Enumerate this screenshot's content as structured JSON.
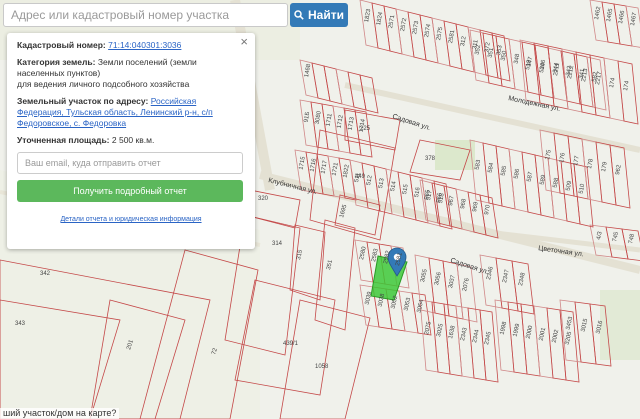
{
  "search": {
    "placeholder": "Адрес или кадастровый номер участка",
    "button_label": "Найти"
  },
  "panel": {
    "close_label": "×",
    "cadastral_label": "Кадастровый номер:",
    "cadastral_value": "71:14:040301:3036",
    "category_label": "Категория земель:",
    "category_value_1": "Земли поселений (земли",
    "category_value_2": "населенных пунктов)",
    "category_value_3": "для ведения личного подсобного хозяйства",
    "address_label": "Земельный участок по адресу:",
    "address_value_1": "Российская",
    "address_value_2": "Федерация, Тульская область, Ленинский р-н, с/п",
    "address_value_3": "Федоровское, с. Федоровка",
    "area_label": "Уточненная площадь:",
    "area_value": "2 500 кв.м.",
    "email_placeholder": "Ваш email, куда отправить отчет",
    "report_button": "Получить подробный отчет",
    "details_link": "Детали отчета и юридическая информация"
  },
  "bottom_prompt": "ший участок/дом на карте?",
  "map": {
    "streets": [
      "Клубничная ул.",
      "Цветочная ул.",
      "Садовая ул.",
      "Молодежная ул.",
      "Садовая ул."
    ],
    "parcel_labels": [
      "342",
      "343",
      "201",
      "72",
      "314",
      "315",
      "351",
      "439/1",
      "1058",
      "320",
      "449",
      "225",
      "378",
      "1695",
      "2580",
      "2583",
      "2582",
      "2581",
      "3039",
      "3038",
      "3052",
      "3053",
      "3054",
      "3055",
      "3056",
      "3037",
      "2076",
      "2075",
      "3025",
      "1638",
      "2343",
      "2344",
      "2345",
      "2346",
      "2347",
      "2348",
      "1998",
      "1999",
      "2000",
      "2001",
      "2002",
      "3205",
      "3453",
      "3015",
      "3016",
      "4/3",
      "745",
      "748",
      "91Б",
      "3080",
      "1711",
      "1712",
      "1713",
      "1714",
      "1715",
      "1716",
      "1717",
      "1721",
      "1822",
      "1823",
      "1824",
      "2571",
      "2572",
      "2573",
      "2574",
      "2575",
      "2581",
      "312",
      "311",
      "372",
      "353",
      "352",
      "351",
      "350",
      "348",
      "347",
      "346",
      "344",
      "342",
      "341",
      "582",
      "583",
      "584",
      "585",
      "586",
      "587",
      "589",
      "588",
      "509",
      "510",
      "511",
      "512",
      "513",
      "514",
      "515",
      "516",
      "517",
      "518",
      "519",
      "520",
      "2211",
      "2212",
      "2213",
      "2217",
      "174",
      "174",
      "175",
      "176",
      "177",
      "178",
      "179",
      "962",
      "965",
      "966",
      "967",
      "968",
      "969",
      "970",
      "1462",
      "1465",
      "1466",
      "1467",
      "1468"
    ]
  },
  "colors": {
    "parcel": "#c44848",
    "parcel_dim": "#d89595",
    "highlight": "#43c93a",
    "marker": "#337ab7",
    "road": "#e6e3d6",
    "green": "#dfeace"
  }
}
